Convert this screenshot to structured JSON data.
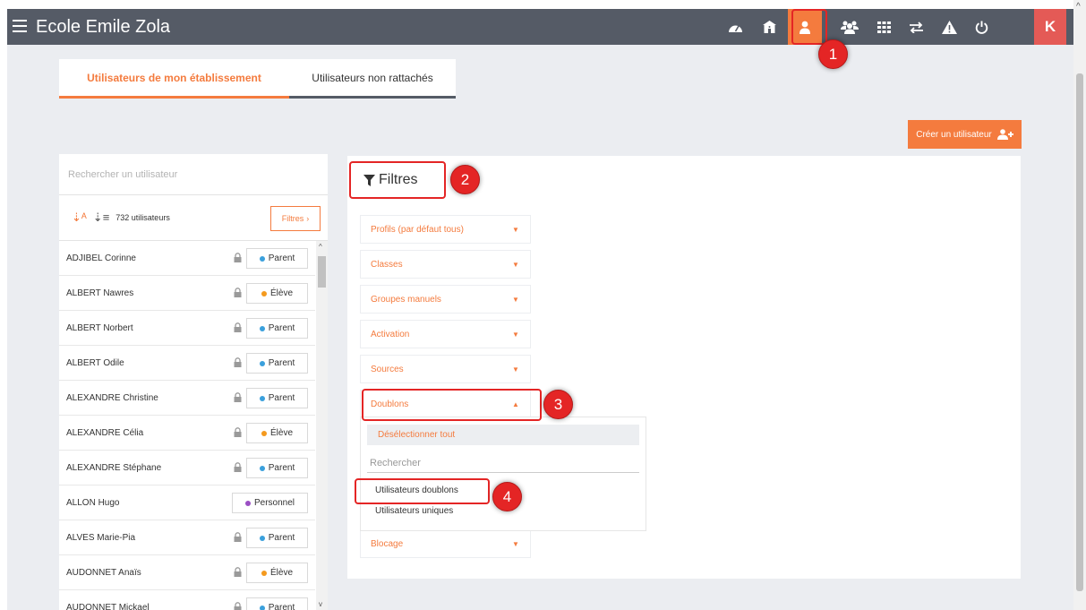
{
  "header": {
    "title": "Ecole Emile Zola",
    "icons": [
      "dashboard-icon",
      "school-icon",
      "user-icon",
      "group-icon",
      "grid-icon",
      "transfer-icon",
      "warning-icon",
      "power-icon",
      "k-icon"
    ],
    "k_label": "K"
  },
  "tabs": [
    {
      "label": "Utilisateurs de mon établissement",
      "active": true
    },
    {
      "label": "Utilisateurs non rattachés",
      "active": false
    }
  ],
  "create_button": {
    "label": "Créer un utilisateur"
  },
  "user_panel": {
    "search_placeholder": "Rechercher un utilisateur",
    "count_label": "732 utilisateurs",
    "filters_button": "Filtres",
    "users": [
      {
        "name": "ADJIBEL Corinne",
        "role": "Parent",
        "locked": true
      },
      {
        "name": "ALBERT Nawres",
        "role": "Élève",
        "locked": true
      },
      {
        "name": "ALBERT Norbert",
        "role": "Parent",
        "locked": true
      },
      {
        "name": "ALBERT Odile",
        "role": "Parent",
        "locked": true
      },
      {
        "name": "ALEXANDRE Christine",
        "role": "Parent",
        "locked": true
      },
      {
        "name": "ALEXANDRE Célia",
        "role": "Élève",
        "locked": true
      },
      {
        "name": "ALEXANDRE Stéphane",
        "role": "Parent",
        "locked": true
      },
      {
        "name": "ALLON Hugo",
        "role": "Personnel",
        "locked": false
      },
      {
        "name": "ALVES Marie-Pia",
        "role": "Parent",
        "locked": true
      },
      {
        "name": "AUDONNET Anaïs",
        "role": "Élève",
        "locked": true
      },
      {
        "name": "AUDONNET Mickael",
        "role": "Parent",
        "locked": true
      }
    ],
    "role_colors": {
      "Parent": "#3aa0dc",
      "Élève": "#f49a1e",
      "Personnel": "#9b4fc4"
    }
  },
  "filters_panel": {
    "title": "Filtres",
    "items": [
      {
        "label": "Profils (par défaut tous)",
        "caret": "▼"
      },
      {
        "label": "Classes",
        "caret": "▼"
      },
      {
        "label": "Groupes manuels",
        "caret": "▼"
      },
      {
        "label": "Activation",
        "caret": "▼"
      },
      {
        "label": "Sources",
        "caret": "▼"
      },
      {
        "label": "Doublons",
        "caret": "▲"
      },
      {
        "label": "Blocage",
        "caret": "▼"
      }
    ],
    "dropdown": {
      "deselect_label": "Désélectionner tout",
      "search_placeholder": "Rechercher",
      "options": [
        "Utilisateurs doublons",
        "Utilisateurs uniques"
      ]
    }
  },
  "callouts": [
    "1",
    "2",
    "3",
    "4"
  ],
  "colors": {
    "accent": "#f47b3e",
    "topbar": "#555b66",
    "callout": "#e42525"
  }
}
